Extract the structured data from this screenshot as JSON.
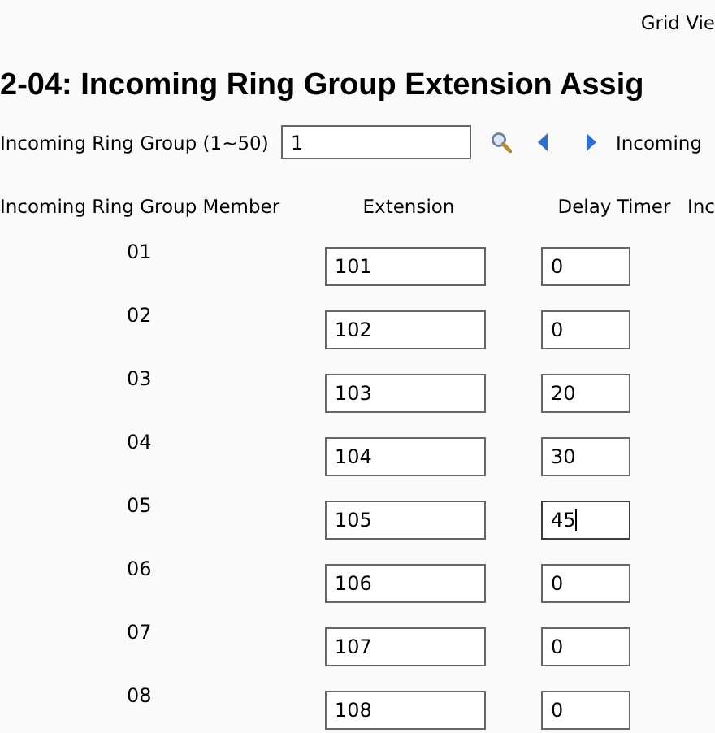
{
  "view_link": "Grid Vie",
  "heading": "2-04: Incoming Ring Group Extension Assig",
  "group_selector": {
    "label": "Incoming Ring Group (1~50)",
    "value": "1",
    "next_label": "Incoming"
  },
  "table": {
    "columns": [
      "Incoming Ring Group Member",
      "Extension",
      "Delay Timer",
      "Inc"
    ],
    "rows": [
      {
        "member": "01",
        "extension": "101",
        "delay": "0",
        "focused": false
      },
      {
        "member": "02",
        "extension": "102",
        "delay": "0",
        "focused": false
      },
      {
        "member": "03",
        "extension": "103",
        "delay": "20",
        "focused": false
      },
      {
        "member": "04",
        "extension": "104",
        "delay": "30",
        "focused": false
      },
      {
        "member": "05",
        "extension": "105",
        "delay": "45",
        "focused": true
      },
      {
        "member": "06",
        "extension": "106",
        "delay": "0",
        "focused": false
      },
      {
        "member": "07",
        "extension": "107",
        "delay": "0",
        "focused": false
      },
      {
        "member": "08",
        "extension": "108",
        "delay": "0",
        "focused": false
      }
    ]
  }
}
